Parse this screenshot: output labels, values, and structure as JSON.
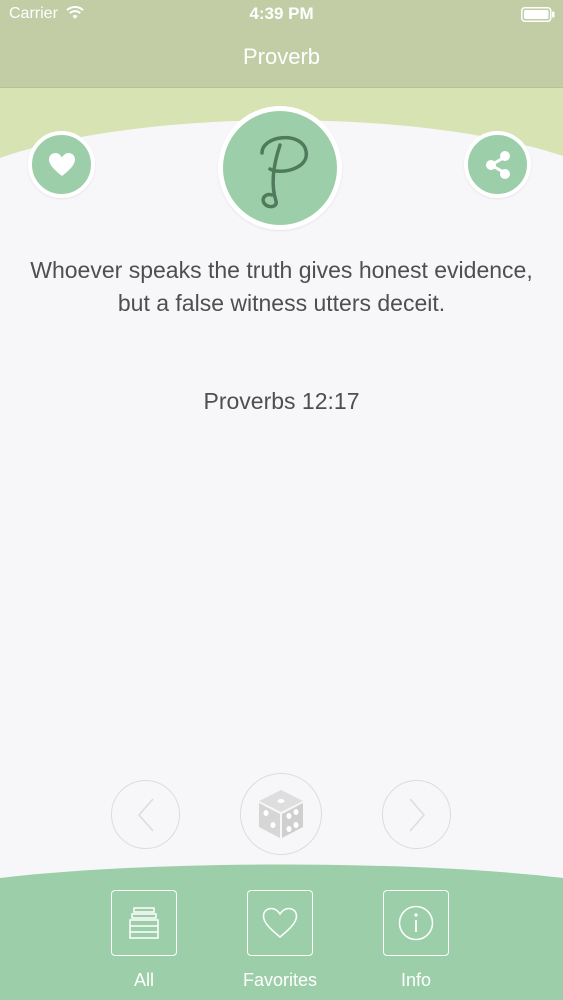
{
  "status_bar": {
    "carrier": "Carrier",
    "time": "4:39 PM"
  },
  "nav": {
    "title": "Proverb"
  },
  "logo": {
    "letter": "P"
  },
  "proverb": {
    "text": "Whoever speaks the truth gives honest evidence, but a false witness utters deceit.",
    "reference": "Proverbs 12:17"
  },
  "controls": {
    "prev_icon": "chevron-left-icon",
    "random_icon": "dice-icon",
    "next_icon": "chevron-right-icon"
  },
  "tabs": [
    {
      "label": "All",
      "icon": "stack-icon"
    },
    {
      "label": "Favorites",
      "icon": "heart-icon"
    },
    {
      "label": "Info",
      "icon": "info-icon"
    }
  ],
  "colors": {
    "header": "#c3cda5",
    "header_band": "#d8e3b4",
    "accent_green": "#9ccfa9",
    "tab_bar": "#9ccfa9",
    "text": "#4f4f53",
    "background": "#f7f7f9"
  }
}
